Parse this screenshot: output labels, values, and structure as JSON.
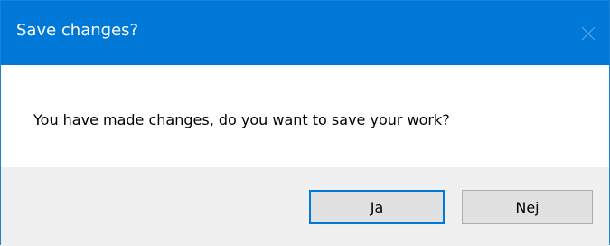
{
  "dialog": {
    "title": "Save changes?",
    "close_icon": "close-icon",
    "message": "You have made changes, do you want to save your work?",
    "buttons": {
      "yes_label": "Ja",
      "no_label": "Nej"
    }
  },
  "colors": {
    "titlebar": "#0078d7",
    "footer": "#f0f0f0",
    "button_face": "#e1e1e1",
    "default_button_border": "#0078d7"
  }
}
